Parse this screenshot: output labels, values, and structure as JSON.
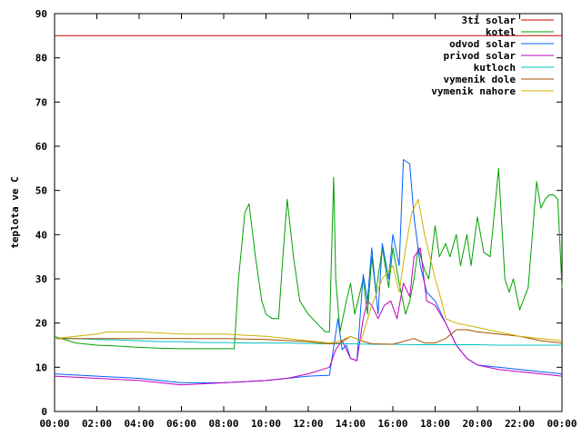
{
  "chart_data": {
    "type": "line",
    "title": "",
    "xlabel": "",
    "ylabel": "teplota ve C",
    "xlim": [
      0,
      24
    ],
    "ylim": [
      0,
      90
    ],
    "x_ticks": [
      "00:00",
      "02:00",
      "04:00",
      "06:00",
      "08:00",
      "10:00",
      "12:00",
      "14:00",
      "16:00",
      "18:00",
      "20:00",
      "22:00",
      "00:00"
    ],
    "y_ticks": [
      "0",
      "10",
      "20",
      "30",
      "40",
      "50",
      "60",
      "70",
      "80",
      "90"
    ],
    "grid": false,
    "legend_position": "top-right",
    "series": [
      {
        "name": "3ti solar",
        "color": "#cc0000",
        "x": [
          0,
          24
        ],
        "y": [
          85,
          85
        ]
      },
      {
        "name": "kotel",
        "color": "#00a000",
        "x": [
          0,
          1,
          2,
          3,
          4,
          5,
          6,
          7,
          8,
          8.5,
          8.7,
          9,
          9.2,
          9.5,
          9.8,
          10,
          10.3,
          10.6,
          10.8,
          11,
          11.3,
          11.6,
          12,
          12.4,
          12.8,
          13,
          13.2,
          13.3,
          13.5,
          13.8,
          14,
          14.2,
          14.4,
          14.6,
          14.8,
          15,
          15.2,
          15.5,
          15.8,
          16,
          16.3,
          16.6,
          16.8,
          17,
          17.2,
          17.5,
          17.7,
          18,
          18.2,
          18.5,
          18.7,
          19,
          19.2,
          19.5,
          19.7,
          20,
          20.3,
          20.6,
          21,
          21.3,
          21.5,
          21.7,
          22,
          22.4,
          22.8,
          23,
          23.2,
          23.4,
          23.6,
          23.8,
          24
        ],
        "y": [
          17,
          15.5,
          15,
          14.8,
          14.5,
          14.3,
          14.2,
          14.2,
          14.2,
          14.2,
          30,
          45,
          47,
          35,
          25,
          22,
          21,
          21,
          35,
          48,
          35,
          25,
          22,
          20,
          18,
          18,
          53,
          30,
          18,
          25,
          29,
          22,
          26,
          30,
          22,
          35,
          27,
          37,
          28,
          37,
          29,
          22,
          25,
          30,
          37,
          32,
          30,
          42,
          35,
          38,
          35,
          40,
          33,
          40,
          33,
          44,
          36,
          35,
          55,
          30,
          27,
          30,
          23,
          28,
          52,
          46,
          48,
          49,
          49,
          48,
          28
        ]
      },
      {
        "name": "odvod solar",
        "color": "#0060ff",
        "x": [
          0,
          2,
          4,
          6,
          8,
          10,
          11,
          12,
          13,
          13.4,
          13.6,
          13.8,
          14,
          14.3,
          14.6,
          14.8,
          15,
          15.3,
          15.5,
          15.8,
          16,
          16.3,
          16.5,
          16.8,
          17,
          17.3,
          17.6,
          18,
          18.5,
          19,
          19.5,
          20,
          21,
          22,
          23,
          24
        ],
        "y": [
          8.5,
          8,
          7.5,
          6.5,
          6.5,
          7,
          7.5,
          8,
          8.2,
          21,
          14,
          15,
          12,
          11.5,
          31,
          25,
          37,
          22,
          38,
          30,
          40,
          33,
          57,
          56,
          44,
          33,
          27,
          25,
          20,
          15,
          12,
          10.5,
          10,
          9.5,
          9,
          8.5
        ]
      },
      {
        "name": "privod solar",
        "color": "#c000c0",
        "x": [
          0,
          2,
          4,
          6,
          8,
          10,
          11,
          12,
          13,
          13.3,
          13.6,
          14,
          14.3,
          14.6,
          14.8,
          15,
          15.3,
          15.6,
          15.9,
          16.2,
          16.5,
          16.8,
          17,
          17.3,
          17.6,
          18,
          18.5,
          19,
          19.5,
          20,
          21,
          22,
          23,
          24
        ],
        "y": [
          8,
          7.5,
          7,
          6,
          6.5,
          7,
          7.5,
          8.5,
          10,
          14,
          16,
          12,
          11.5,
          21,
          25,
          24,
          21,
          24,
          25,
          21,
          29,
          26,
          35,
          37,
          25,
          24,
          20,
          15,
          12,
          10.5,
          9.5,
          9,
          8.5,
          8
        ]
      },
      {
        "name": "kutloch",
        "color": "#00c0c0",
        "x": [
          0,
          1,
          2,
          3,
          4,
          5,
          6,
          7,
          8,
          9,
          10,
          11,
          12,
          13,
          14,
          15,
          16,
          17,
          18,
          19,
          20,
          21,
          22,
          23,
          24
        ],
        "y": [
          16.5,
          16.5,
          16.3,
          16.2,
          16,
          15.8,
          15.8,
          15.6,
          15.6,
          15.5,
          15.5,
          15.5,
          15.4,
          15.3,
          15.3,
          15.2,
          15.2,
          15.1,
          15.1,
          15.1,
          15.1,
          15,
          15,
          15,
          15
        ]
      },
      {
        "name": "vymenik dole",
        "color": "#a05000",
        "x": [
          0,
          2,
          4,
          6,
          8,
          10,
          12,
          13,
          13.5,
          14,
          14.5,
          15,
          16,
          17,
          17.5,
          18,
          18.5,
          19,
          19.5,
          20,
          21,
          22,
          23,
          24
        ],
        "y": [
          16.5,
          16.5,
          16.5,
          16.5,
          16.5,
          16.3,
          15.8,
          15.3,
          15.5,
          17,
          16,
          15.3,
          15.2,
          16.5,
          15.5,
          15.5,
          16.5,
          18.5,
          18.5,
          18,
          17.5,
          17,
          16,
          15.5
        ]
      },
      {
        "name": "vymenik nahore",
        "color": "#d0b000",
        "x": [
          0,
          1,
          2,
          2.5,
          4,
          6,
          8,
          10,
          12,
          13,
          13.5,
          14,
          14.5,
          15,
          15.5,
          16,
          16.3,
          16.6,
          16.9,
          17.2,
          17.5,
          17.8,
          18,
          18.3,
          18.5,
          19,
          19.5,
          20,
          21,
          22,
          23,
          24
        ],
        "y": [
          16.5,
          17,
          17.5,
          18,
          18,
          17.5,
          17.5,
          17,
          16,
          15.5,
          16,
          17,
          16,
          24,
          30,
          33,
          27,
          37,
          45,
          48,
          40,
          34,
          30,
          25,
          21,
          20,
          19.5,
          19,
          18,
          17,
          16.5,
          16
        ]
      }
    ]
  }
}
